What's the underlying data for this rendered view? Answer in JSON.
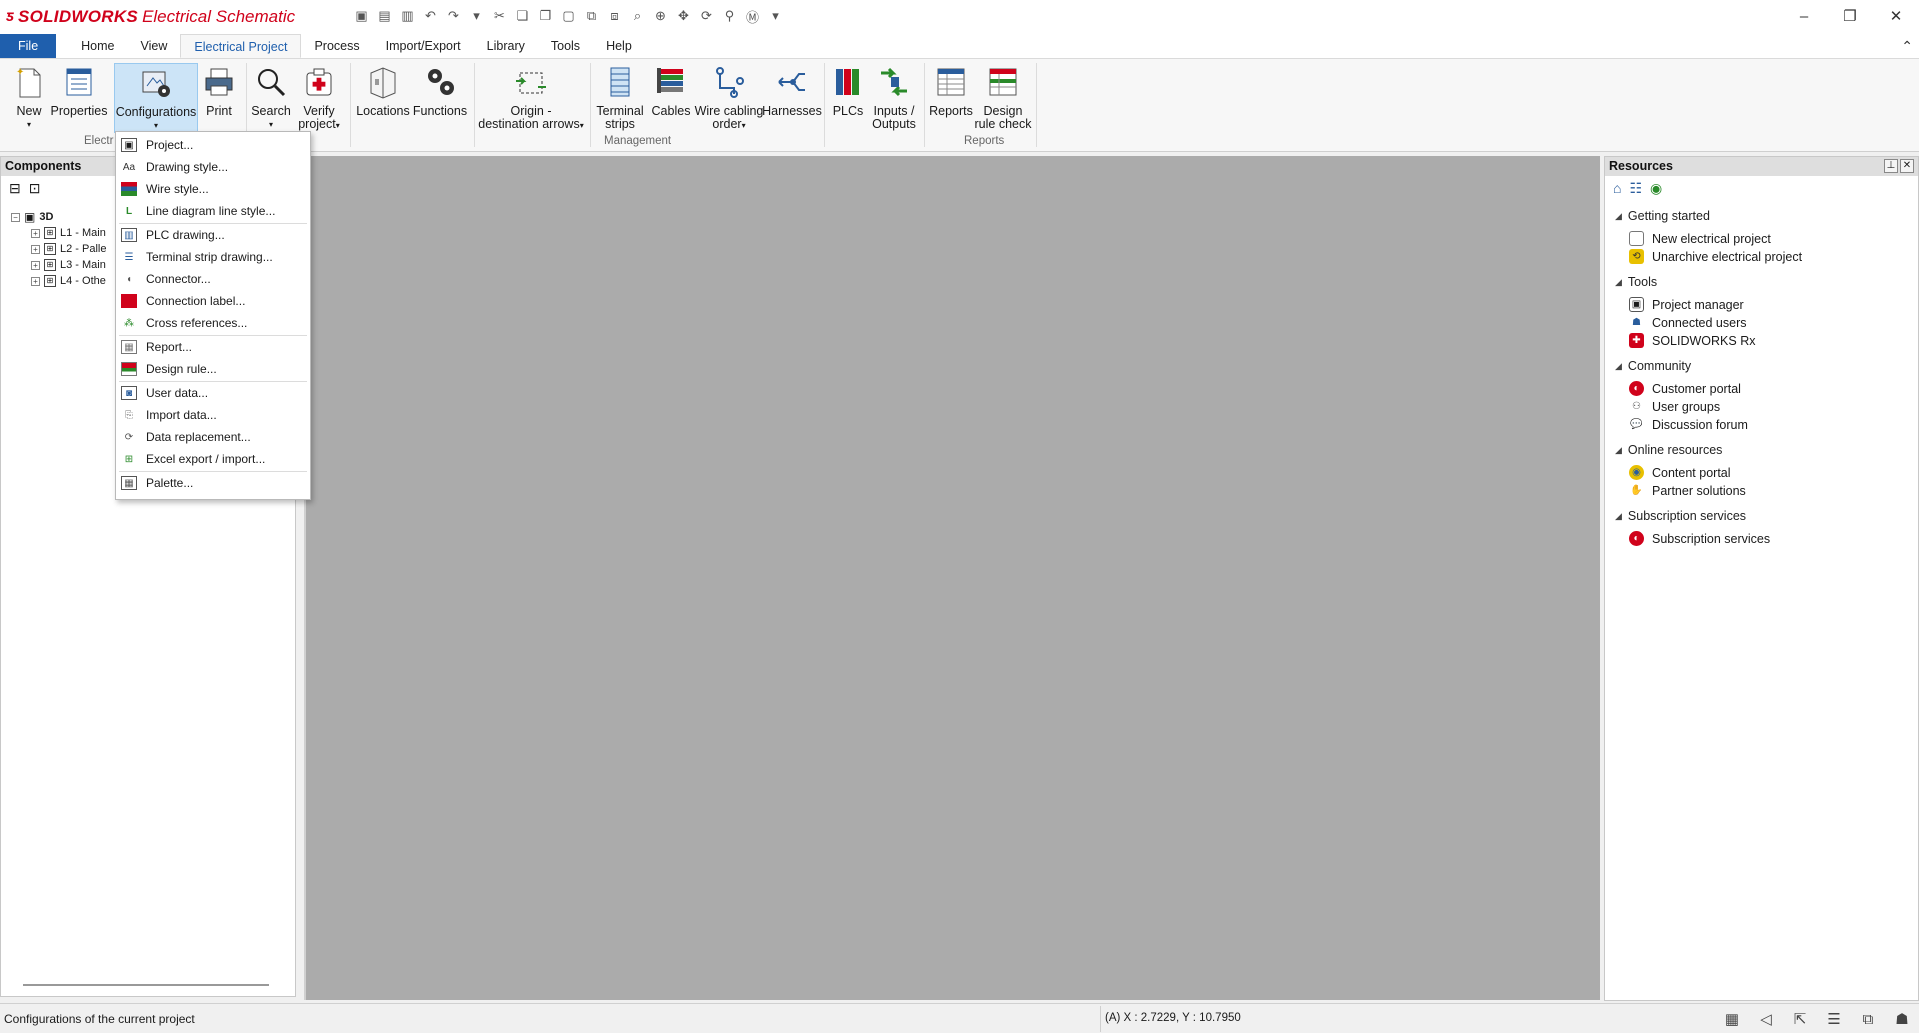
{
  "app": {
    "brand": "SOLIDWORKS",
    "product": "Electrical Schematic",
    "brand_color": "#d0021b",
    "accent_color": "#1f5fad"
  },
  "quick_access": [
    "project-icon",
    "save-icon",
    "print-icon",
    "undo-icon",
    "redo-icon",
    "customize-icon",
    "cut-icon",
    "copy-icon",
    "paste-icon",
    "paste-special-icon",
    "copy-format-icon",
    "duplicate-icon",
    "zoom-icon",
    "zoom-window-icon",
    "pan-icon",
    "regenerate-icon",
    "search-icon",
    "macro-icon",
    "dropdown-icon"
  ],
  "window_controls": {
    "minimize": "–",
    "restore": "❐",
    "close": "✕"
  },
  "tabs": [
    "File",
    "Home",
    "View",
    "Electrical Project",
    "Process",
    "Import/Export",
    "Library",
    "Tools",
    "Help"
  ],
  "active_tab": "Electrical Project",
  "ribbon": {
    "buttons": {
      "new": "New",
      "properties": "Properties",
      "configurations": "Configurations",
      "print": "Print",
      "search": "Search",
      "verify_1": "Verify",
      "verify_2": "project",
      "locations": "Locations",
      "functions": "Functions",
      "origin_1": "Origin -",
      "origin_2": "destination arrows",
      "terminal_1": "Terminal",
      "terminal_2": "strips",
      "cables": "Cables",
      "wire_1": "Wire cabling",
      "wire_2": "order",
      "harnesses": "Harnesses",
      "plcs": "PLCs",
      "io_1": "Inputs /",
      "io_2": "Outputs",
      "reports": "Reports",
      "drc_1": "Design",
      "drc_2": "rule check"
    },
    "groups": {
      "electrical": "Electr",
      "management": "Management",
      "reports": "Reports"
    }
  },
  "components_panel": {
    "title": "Components",
    "tree": {
      "root": "3D",
      "children": [
        "L1 - Main",
        "L2 - Palle",
        "L3 - Main",
        "L4 - Othe"
      ]
    }
  },
  "config_menu": {
    "items": [
      {
        "label": "Project...",
        "icon": "project-config-icon"
      },
      {
        "label": "Drawing style...",
        "icon": "drawing-style-icon"
      },
      {
        "label": "Wire style...",
        "icon": "wire-style-icon"
      },
      {
        "label": "Line diagram line style...",
        "icon": "line-style-icon"
      },
      {
        "label": "PLC drawing...",
        "icon": "plc-drawing-icon"
      },
      {
        "label": "Terminal strip drawing...",
        "icon": "terminal-strip-icon"
      },
      {
        "label": "Connector...",
        "icon": "connector-icon"
      },
      {
        "label": "Connection label...",
        "icon": "connection-label-icon"
      },
      {
        "label": "Cross references...",
        "icon": "cross-references-icon"
      },
      {
        "label": "Report...",
        "icon": "report-icon"
      },
      {
        "label": "Design rule...",
        "icon": "design-rule-icon"
      },
      {
        "label": "User data...",
        "icon": "user-data-icon"
      },
      {
        "label": "Import data...",
        "icon": "import-data-icon"
      },
      {
        "label": "Data replacement...",
        "icon": "data-replacement-icon"
      },
      {
        "label": "Excel export / import...",
        "icon": "excel-icon"
      },
      {
        "label": "Palette...",
        "icon": "palette-icon"
      }
    ]
  },
  "resources_panel": {
    "title": "Resources",
    "sections": [
      {
        "title": "Getting started",
        "items": [
          "New electrical project",
          "Unarchive electrical project"
        ]
      },
      {
        "title": "Tools",
        "items": [
          "Project manager",
          "Connected users",
          "SOLIDWORKS Rx"
        ]
      },
      {
        "title": "Community",
        "items": [
          "Customer portal",
          "User groups",
          "Discussion forum"
        ]
      },
      {
        "title": "Online resources",
        "items": [
          "Content portal",
          "Partner solutions"
        ]
      },
      {
        "title": "Subscription services",
        "items": [
          "Subscription services"
        ]
      }
    ]
  },
  "status": {
    "text": "Configurations of the current project",
    "coords": "(A) X : 2.7229, Y : 10.7950"
  }
}
